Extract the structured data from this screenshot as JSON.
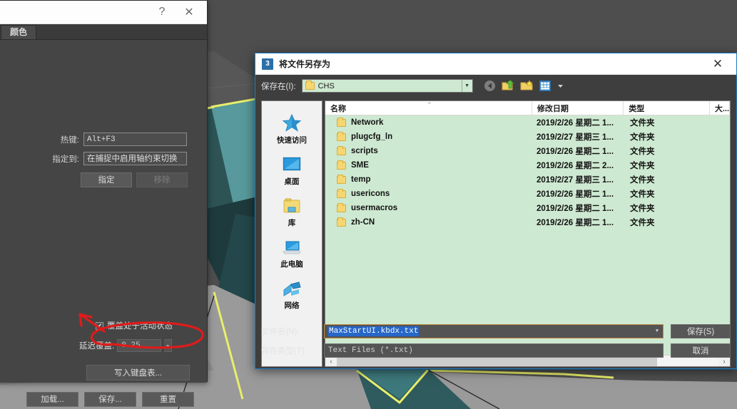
{
  "hotkey_dialog": {
    "titlebar": {
      "help": "?",
      "close": "✕"
    },
    "tab": "颜色",
    "hotkey_label": "热键:",
    "hotkey_value": "Alt+F3",
    "assigned_label": "指定到:",
    "assigned_value": "在捕捉中启用轴约束切换",
    "assign_button": "指定",
    "remove_button": "移除",
    "override_checkbox_label": "覆盖处于活动状态",
    "override_checked": "✔",
    "delay_label": "延迟覆盖:",
    "delay_value": "0.25",
    "write_keyboard_button": "写入键盘表...",
    "load_button": "加载...",
    "save_button": "保存...",
    "reset_button": "重置"
  },
  "save_dialog": {
    "app_icon_text": "3",
    "title": "将文件另存为",
    "close": "✕",
    "look_in_label": "保存在(I):",
    "look_in_value": "CHS",
    "combo_arrow": "▼",
    "toolbar": [
      {
        "name": "back-icon",
        "glyph": "◀"
      },
      {
        "name": "up-folder-icon",
        "glyph": "↑"
      },
      {
        "name": "new-folder-icon",
        "glyph": "★"
      },
      {
        "name": "views-icon",
        "glyph": "▦"
      },
      {
        "name": "views-dropdown-icon",
        "glyph": "▾"
      }
    ],
    "places": [
      {
        "label": "快速访问",
        "icon": "quick-access-icon"
      },
      {
        "label": "桌面",
        "icon": "desktop-icon"
      },
      {
        "label": "库",
        "icon": "libraries-icon"
      },
      {
        "label": "此电脑",
        "icon": "this-pc-icon"
      },
      {
        "label": "网络",
        "icon": "network-icon"
      }
    ],
    "columns": [
      "名称",
      "修改日期",
      "类型",
      "大..."
    ],
    "sort_caret": "⌃",
    "files": [
      {
        "name": "Network",
        "date": "2019/2/26 星期二 1...",
        "type": "文件夹"
      },
      {
        "name": "plugcfg_ln",
        "date": "2019/2/27 星期三 1...",
        "type": "文件夹"
      },
      {
        "name": "scripts",
        "date": "2019/2/26 星期二 1...",
        "type": "文件夹"
      },
      {
        "name": "SME",
        "date": "2019/2/26 星期二 2...",
        "type": "文件夹"
      },
      {
        "name": "temp",
        "date": "2019/2/27 星期三 1...",
        "type": "文件夹"
      },
      {
        "name": "usericons",
        "date": "2019/2/26 星期二 1...",
        "type": "文件夹"
      },
      {
        "name": "usermacros",
        "date": "2019/2/26 星期二 1...",
        "type": "文件夹"
      },
      {
        "name": "zh-CN",
        "date": "2019/2/26 星期二 1...",
        "type": "文件夹"
      }
    ],
    "scroll_left": "‹",
    "scroll_right": "›",
    "filename_label": "文件名(N):",
    "filename_value": "MaxStartUI.kbdx.txt",
    "filetype_label": "保存类型(T):",
    "filetype_value": "Text Files (*.txt)",
    "save_button": "保存(S)",
    "cancel_button": "取消",
    "dropdown_arrow": "▼"
  },
  "colors": {
    "list_green": "#cee9d1",
    "annotation_red": "#e01b1b",
    "dialog_accent": "#1f7fc4",
    "viewport_teal": "#3f7b7e",
    "viewport_yellow": "#e8ef6a"
  }
}
